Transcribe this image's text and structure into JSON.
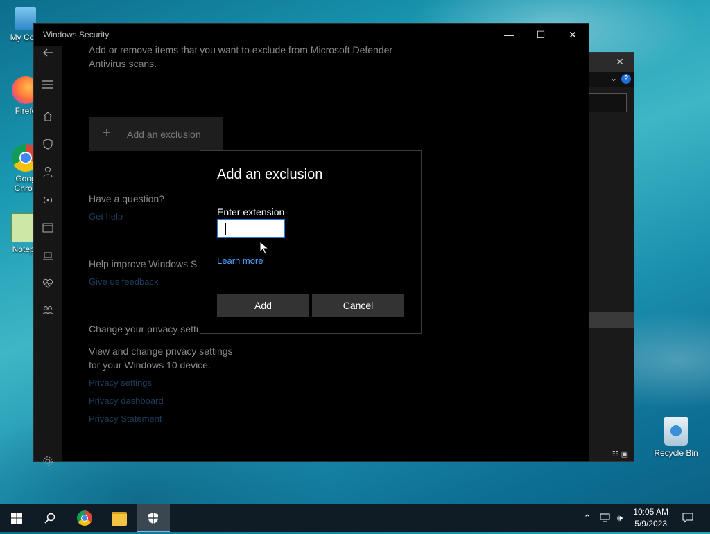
{
  "desktop": {
    "icons": [
      {
        "label": "My Com"
      },
      {
        "label": "Firefo"
      },
      {
        "label": "Goog Chron"
      },
      {
        "label": "Notepa"
      },
      {
        "label": "Recycle Bin"
      }
    ]
  },
  "window": {
    "title": "Windows Security",
    "min_glyph": "—",
    "max_glyph": "☐",
    "close_glyph": "✕",
    "nav_icons": [
      "back-arrow-icon",
      "hamburger-icon",
      "home-icon",
      "shield-icon",
      "person-icon",
      "wireless-icon",
      "app-browser-icon",
      "device-icon",
      "heart-icon",
      "family-icon",
      "gear-icon"
    ]
  },
  "content": {
    "description": "Add or remove items that you want to exclude from Microsoft Defender Antivirus scans.",
    "add_exclusion_label": "Add an exclusion",
    "question_heading": "Have a question?",
    "get_help": "Get help",
    "improve_heading": "Help improve Windows S",
    "feedback_link": "Give us feedback",
    "privacy_heading": "Change your privacy setti",
    "privacy_text_1": "View and change privacy settings",
    "privacy_text_2": "for your Windows 10 device.",
    "privacy_links": [
      "Privacy settings",
      "Privacy dashboard",
      "Privacy Statement"
    ]
  },
  "dialog": {
    "title": "Add an exclusion",
    "label": "Enter extension",
    "input_value": "",
    "learn_more": "Learn more",
    "add_label": "Add",
    "cancel_label": "Cancel"
  },
  "taskbar": {
    "time": "10:05 AM",
    "date": "5/9/2023",
    "items": [
      "start-icon",
      "search-icon",
      "chrome-icon",
      "file-explorer-icon",
      "windows-security-icon"
    ]
  },
  "colors": {
    "accent": "#1e7ad6",
    "link": "#4da3ff",
    "taskbar": "#0f1c25"
  }
}
